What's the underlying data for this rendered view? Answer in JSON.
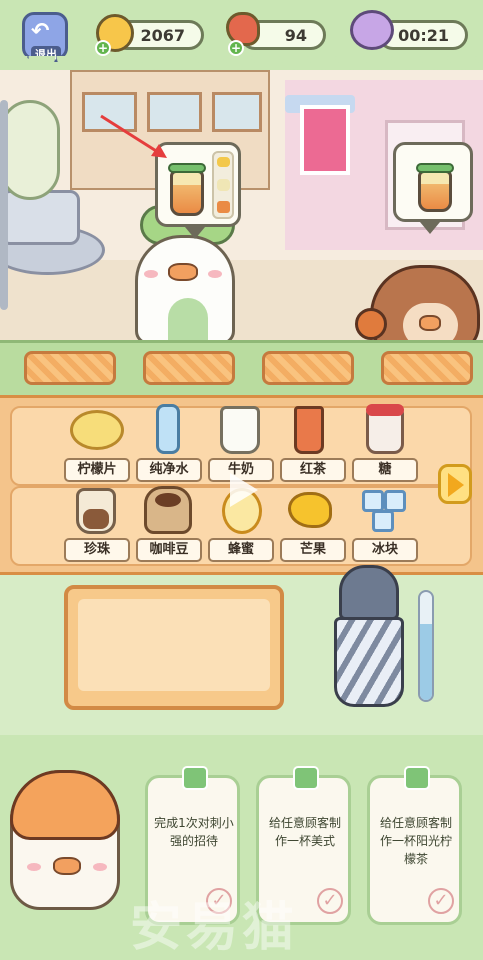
{
  "hud": {
    "back_label": "退出",
    "coins": "2067",
    "meat": "94",
    "timer": "00:21"
  },
  "ingredients": {
    "row1": [
      {
        "label": "柠檬片",
        "icon": "lemon-slices-icon"
      },
      {
        "label": "纯净水",
        "icon": "water-bottle-icon"
      },
      {
        "label": "牛奶",
        "icon": "milk-jug-icon"
      },
      {
        "label": "红茶",
        "icon": "black-tea-icon"
      },
      {
        "label": "糖",
        "icon": "sugar-jar-icon"
      }
    ],
    "row2": [
      {
        "label": "珍珠",
        "icon": "tapioca-pearls-icon"
      },
      {
        "label": "咖啡豆",
        "icon": "coffee-beans-icon"
      },
      {
        "label": "蜂蜜",
        "icon": "honey-icon"
      },
      {
        "label": "芒果",
        "icon": "mango-icon"
      },
      {
        "label": "冰块",
        "icon": "ice-cubes-icon"
      }
    ]
  },
  "tasks": [
    {
      "text": "完成1次对刺小强的招待"
    },
    {
      "text": "给任意顾客制作一杯美式"
    },
    {
      "text": "给任意顾客制作一杯阳光柠檬茶"
    }
  ],
  "watermark": "安易猫",
  "colors": {
    "hud_green": "#c9e6b4",
    "panel_orange": "#f4c48b",
    "label_bg": "#fff8eb",
    "arrow_red": "#e53d3d"
  }
}
